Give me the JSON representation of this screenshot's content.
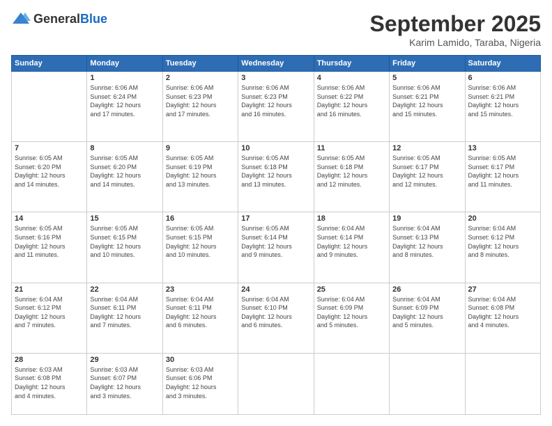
{
  "header": {
    "logo": {
      "general": "General",
      "blue": "Blue"
    },
    "title": "September 2025",
    "subtitle": "Karim Lamido, Taraba, Nigeria"
  },
  "days_of_week": [
    "Sunday",
    "Monday",
    "Tuesday",
    "Wednesday",
    "Thursday",
    "Friday",
    "Saturday"
  ],
  "weeks": [
    [
      {
        "day": "",
        "info": ""
      },
      {
        "day": "1",
        "info": "Sunrise: 6:06 AM\nSunset: 6:24 PM\nDaylight: 12 hours\nand 17 minutes."
      },
      {
        "day": "2",
        "info": "Sunrise: 6:06 AM\nSunset: 6:23 PM\nDaylight: 12 hours\nand 17 minutes."
      },
      {
        "day": "3",
        "info": "Sunrise: 6:06 AM\nSunset: 6:23 PM\nDaylight: 12 hours\nand 16 minutes."
      },
      {
        "day": "4",
        "info": "Sunrise: 6:06 AM\nSunset: 6:22 PM\nDaylight: 12 hours\nand 16 minutes."
      },
      {
        "day": "5",
        "info": "Sunrise: 6:06 AM\nSunset: 6:21 PM\nDaylight: 12 hours\nand 15 minutes."
      },
      {
        "day": "6",
        "info": "Sunrise: 6:06 AM\nSunset: 6:21 PM\nDaylight: 12 hours\nand 15 minutes."
      }
    ],
    [
      {
        "day": "7",
        "info": "Sunrise: 6:05 AM\nSunset: 6:20 PM\nDaylight: 12 hours\nand 14 minutes."
      },
      {
        "day": "8",
        "info": "Sunrise: 6:05 AM\nSunset: 6:20 PM\nDaylight: 12 hours\nand 14 minutes."
      },
      {
        "day": "9",
        "info": "Sunrise: 6:05 AM\nSunset: 6:19 PM\nDaylight: 12 hours\nand 13 minutes."
      },
      {
        "day": "10",
        "info": "Sunrise: 6:05 AM\nSunset: 6:18 PM\nDaylight: 12 hours\nand 13 minutes."
      },
      {
        "day": "11",
        "info": "Sunrise: 6:05 AM\nSunset: 6:18 PM\nDaylight: 12 hours\nand 12 minutes."
      },
      {
        "day": "12",
        "info": "Sunrise: 6:05 AM\nSunset: 6:17 PM\nDaylight: 12 hours\nand 12 minutes."
      },
      {
        "day": "13",
        "info": "Sunrise: 6:05 AM\nSunset: 6:17 PM\nDaylight: 12 hours\nand 11 minutes."
      }
    ],
    [
      {
        "day": "14",
        "info": "Sunrise: 6:05 AM\nSunset: 6:16 PM\nDaylight: 12 hours\nand 11 minutes."
      },
      {
        "day": "15",
        "info": "Sunrise: 6:05 AM\nSunset: 6:15 PM\nDaylight: 12 hours\nand 10 minutes."
      },
      {
        "day": "16",
        "info": "Sunrise: 6:05 AM\nSunset: 6:15 PM\nDaylight: 12 hours\nand 10 minutes."
      },
      {
        "day": "17",
        "info": "Sunrise: 6:05 AM\nSunset: 6:14 PM\nDaylight: 12 hours\nand 9 minutes."
      },
      {
        "day": "18",
        "info": "Sunrise: 6:04 AM\nSunset: 6:14 PM\nDaylight: 12 hours\nand 9 minutes."
      },
      {
        "day": "19",
        "info": "Sunrise: 6:04 AM\nSunset: 6:13 PM\nDaylight: 12 hours\nand 8 minutes."
      },
      {
        "day": "20",
        "info": "Sunrise: 6:04 AM\nSunset: 6:12 PM\nDaylight: 12 hours\nand 8 minutes."
      }
    ],
    [
      {
        "day": "21",
        "info": "Sunrise: 6:04 AM\nSunset: 6:12 PM\nDaylight: 12 hours\nand 7 minutes."
      },
      {
        "day": "22",
        "info": "Sunrise: 6:04 AM\nSunset: 6:11 PM\nDaylight: 12 hours\nand 7 minutes."
      },
      {
        "day": "23",
        "info": "Sunrise: 6:04 AM\nSunset: 6:11 PM\nDaylight: 12 hours\nand 6 minutes."
      },
      {
        "day": "24",
        "info": "Sunrise: 6:04 AM\nSunset: 6:10 PM\nDaylight: 12 hours\nand 6 minutes."
      },
      {
        "day": "25",
        "info": "Sunrise: 6:04 AM\nSunset: 6:09 PM\nDaylight: 12 hours\nand 5 minutes."
      },
      {
        "day": "26",
        "info": "Sunrise: 6:04 AM\nSunset: 6:09 PM\nDaylight: 12 hours\nand 5 minutes."
      },
      {
        "day": "27",
        "info": "Sunrise: 6:04 AM\nSunset: 6:08 PM\nDaylight: 12 hours\nand 4 minutes."
      }
    ],
    [
      {
        "day": "28",
        "info": "Sunrise: 6:03 AM\nSunset: 6:08 PM\nDaylight: 12 hours\nand 4 minutes."
      },
      {
        "day": "29",
        "info": "Sunrise: 6:03 AM\nSunset: 6:07 PM\nDaylight: 12 hours\nand 3 minutes."
      },
      {
        "day": "30",
        "info": "Sunrise: 6:03 AM\nSunset: 6:06 PM\nDaylight: 12 hours\nand 3 minutes."
      },
      {
        "day": "",
        "info": ""
      },
      {
        "day": "",
        "info": ""
      },
      {
        "day": "",
        "info": ""
      },
      {
        "day": "",
        "info": ""
      }
    ]
  ]
}
